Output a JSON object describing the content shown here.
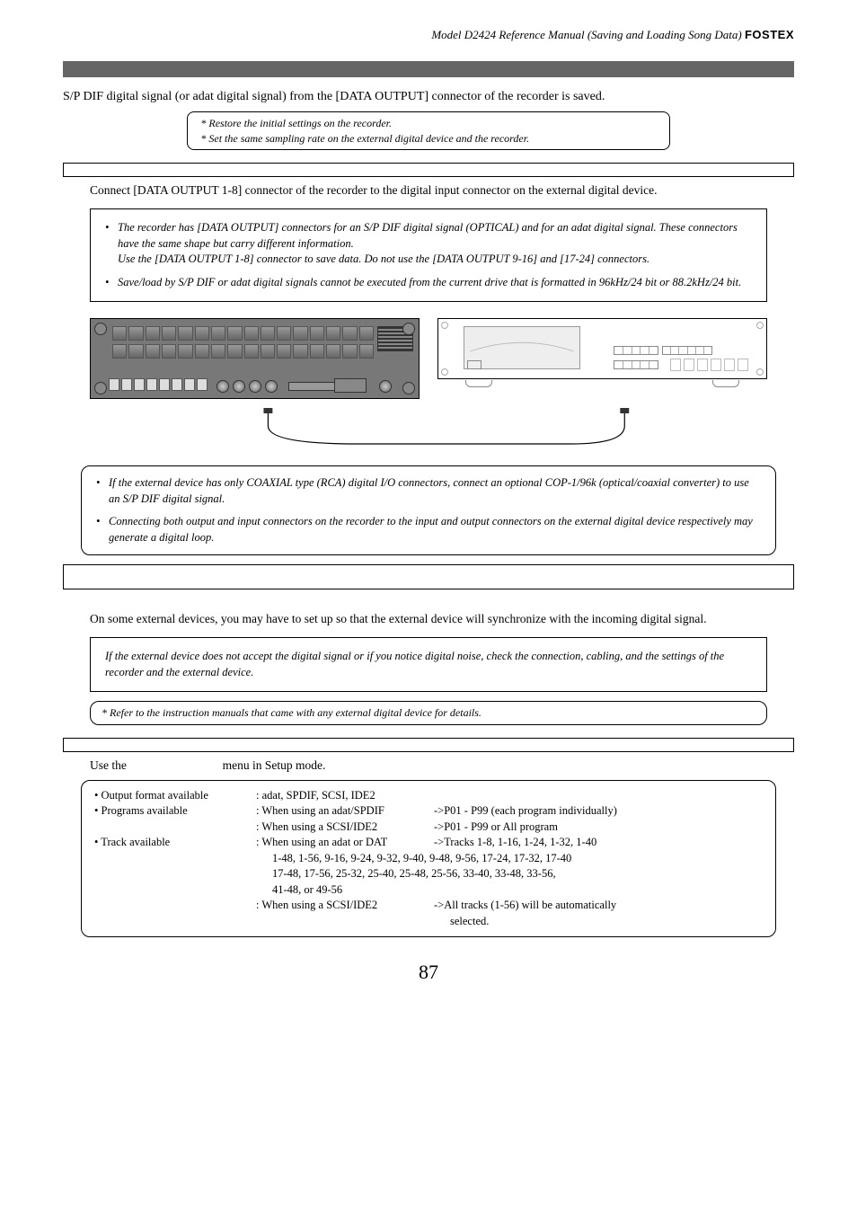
{
  "header": {
    "title": "Model D2424  Reference Manual (Saving and Loading Song Data)",
    "brand": "FOSTEX"
  },
  "intro": "S/P DIF digital signal (or adat digital signal) from the [DATA OUTPUT] connector of the recorder is saved.",
  "thinBox": {
    "line1": "* Restore the initial settings on the recorder.",
    "line2": "* Set the same sampling rate on the external digital device and the recorder."
  },
  "connectText": "Connect [DATA OUTPUT 1-8] connector of the recorder to the digital input connector on the external digital device.",
  "noteBox1": {
    "b1a": "The recorder has [DATA OUTPUT] connectors for an S/P DIF digital signal (OPTICAL) and for an adat digital signal.  These connectors have the same shape but carry different information.",
    "b1b": "Use the [DATA OUTPUT 1-8] connector to save data.  Do not use the [DATA OUTPUT 9-16] and [17-24] connectors.",
    "b2": "Save/load by S/P DIF or adat digital signals cannot be executed from the current drive that is formatted in 96kHz/24 bit or 88.2kHz/24 bit."
  },
  "roundedBox1": {
    "b1": "If the external device has only COAXIAL type (RCA) digital I/O connectors, connect an optional COP-1/96k (optical/coaxial converter) to use an S/P DIF digital signal.",
    "b2": "Connecting both output and input connectors on the recorder to the input and output connectors on the external digital device respectively may generate a digital loop."
  },
  "syncText": "On some external devices, you may have to set up so that the external device will synchronize with the incoming digital signal.",
  "noteBox2": "If the external device does not accept the digital signal or if you notice digital noise, check the connection, cabling, and the settings of the recorder and the external device.",
  "referBox": "* Refer to the instruction manuals that came with any external digital device for details.",
  "setupLine": {
    "a": "Use the",
    "b": "menu in Setup mode."
  },
  "settings": {
    "r1c1": "• Output format available",
    "r1c2": ":  adat, SPDIF, SCSI, IDE2",
    "r2c1": "• Programs available",
    "r2c2": ": When using an adat/SPDIF",
    "r2c3": "->P01 - P99 (each program individually)",
    "r3c2": ": When using a SCSI/IDE2",
    "r3c3": "->P01 - P99 or All program",
    "r4c1": "• Track available",
    "r4c2": ": When using an adat or DAT",
    "r4c3": "->Tracks 1-8, 1-16, 1-24, 1-32, 1-40",
    "r5": "1-48, 1-56, 9-16, 9-24, 9-32, 9-40, 9-48, 9-56, 17-24, 17-32, 17-40",
    "r6": "17-48, 17-56, 25-32, 25-40, 25-48, 25-56, 33-40, 33-48, 33-56,",
    "r7": "41-48, or 49-56",
    "r8c2": ": When using a SCSI/IDE2",
    "r8c3": "->All tracks (1-56) will be automatically",
    "r9": "selected."
  },
  "pageNum": "87"
}
